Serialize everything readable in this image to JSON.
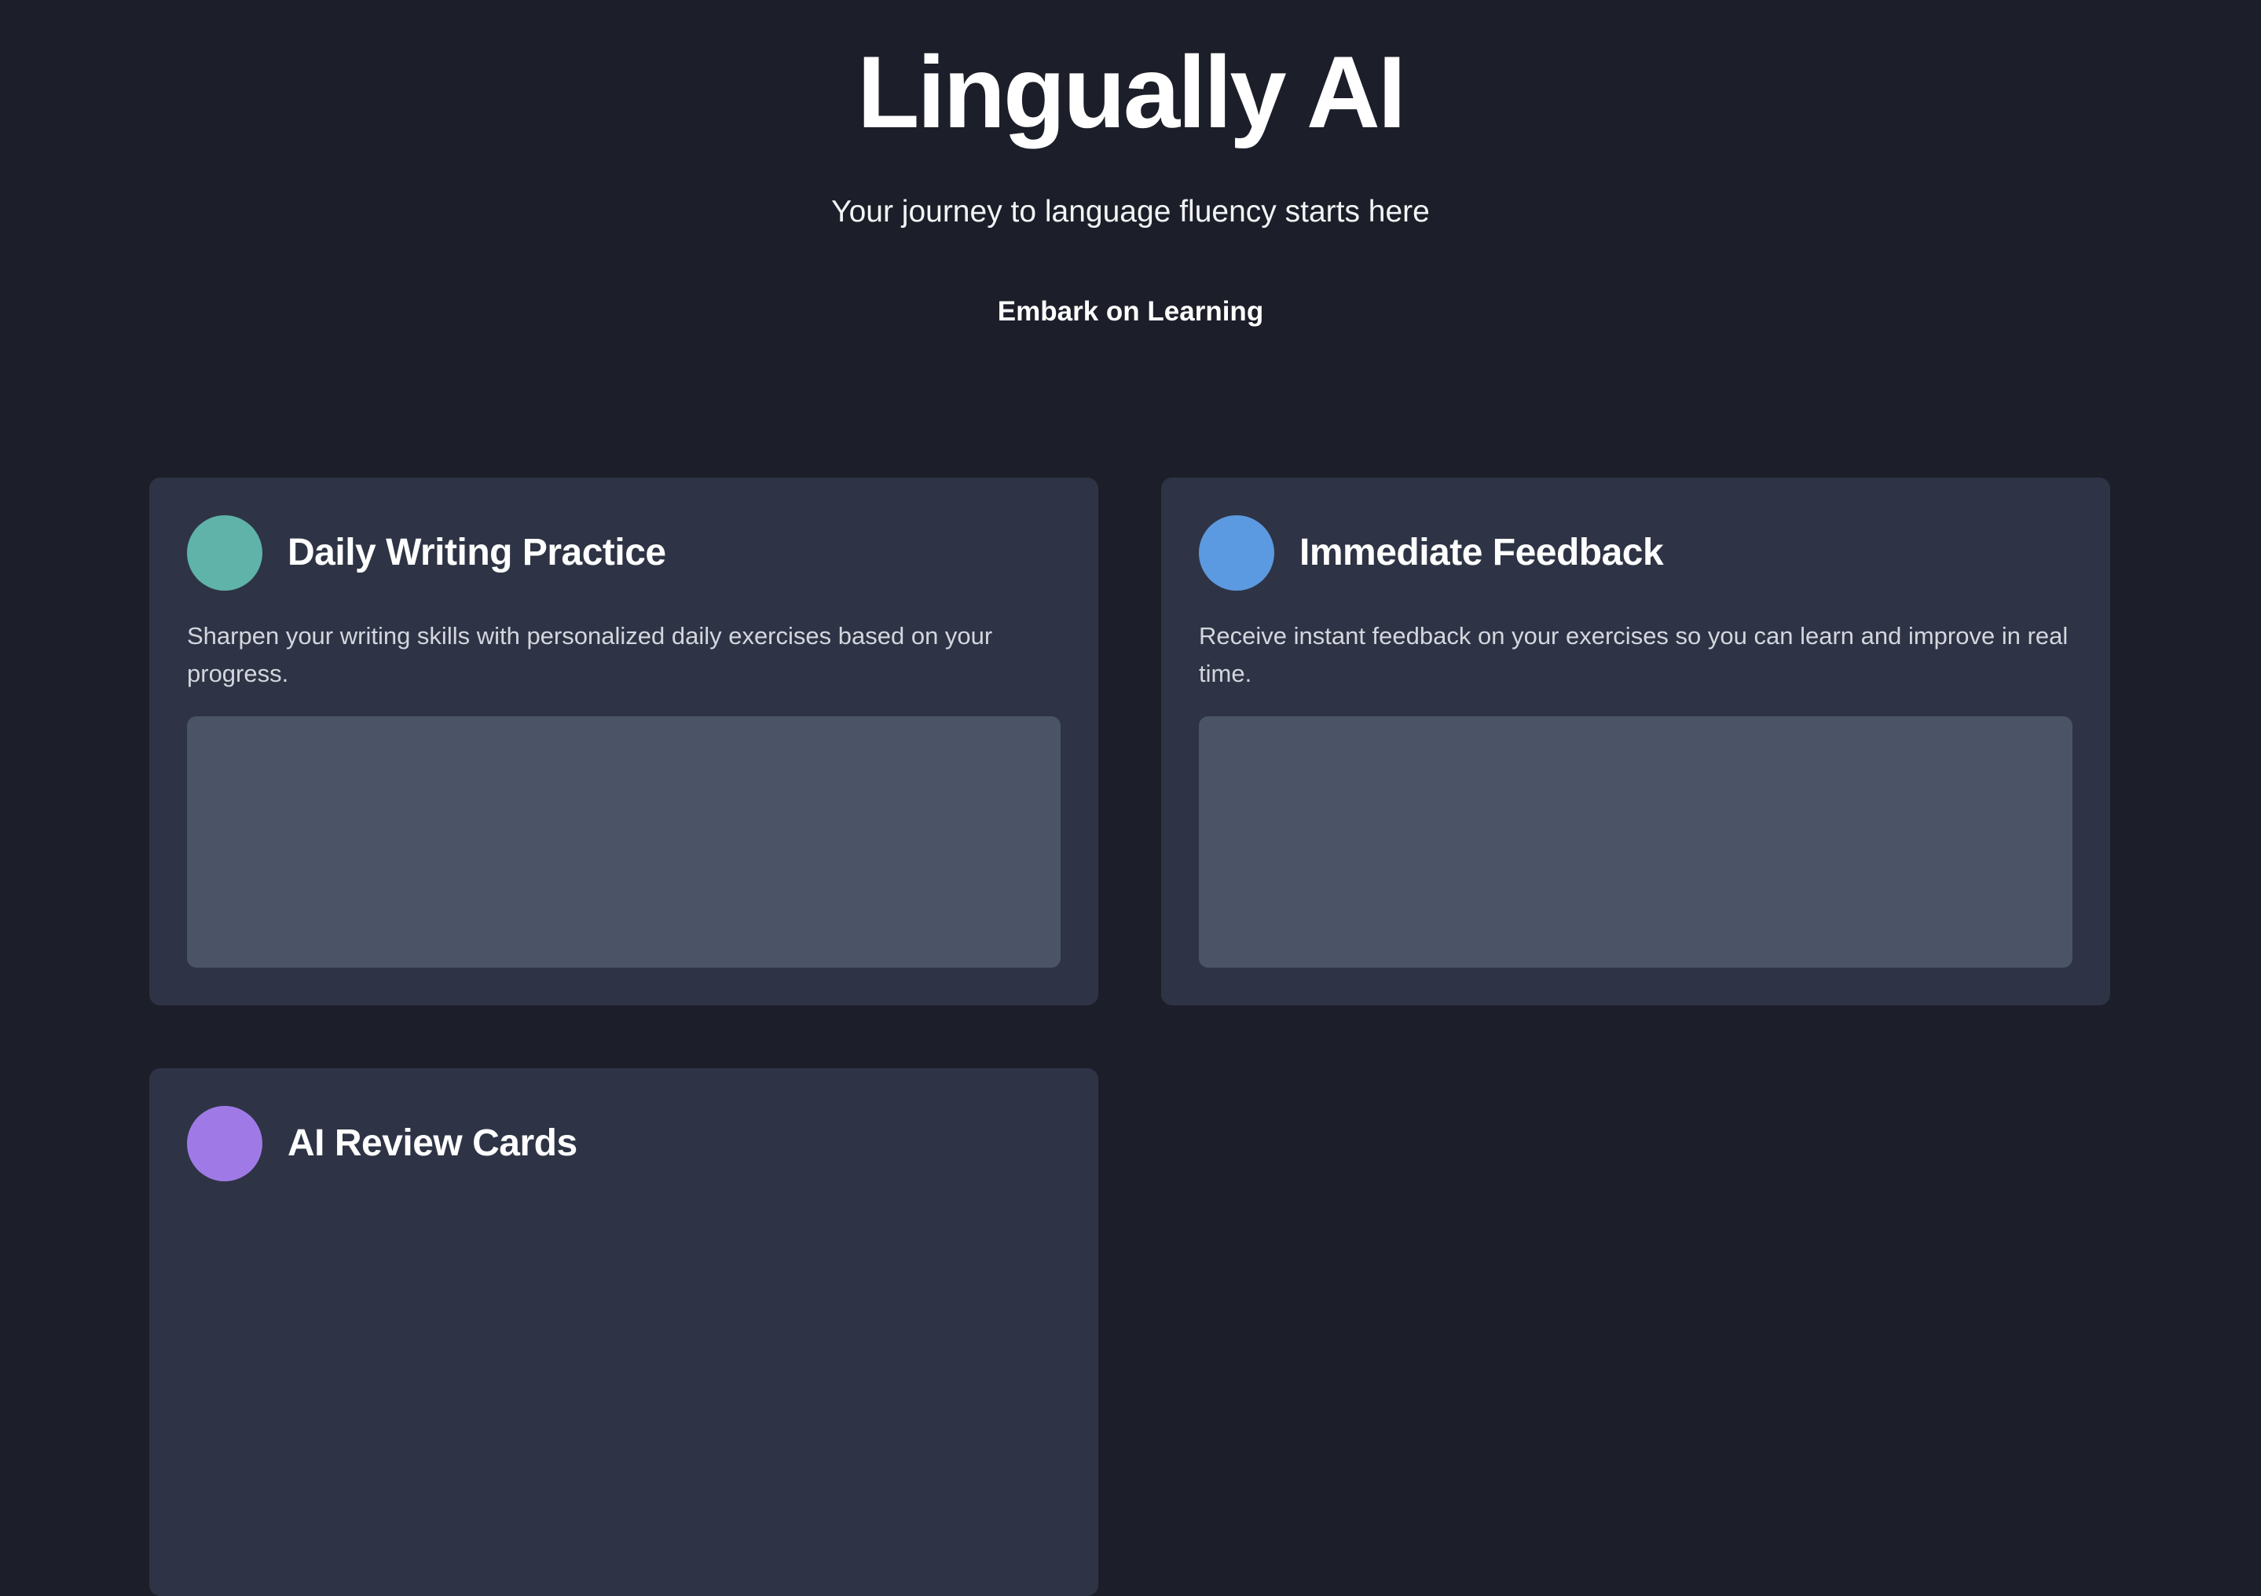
{
  "hero": {
    "title": "Lingually AI",
    "subtitle": "Your journey to language fluency starts here",
    "cta_label": "Embark on Learning"
  },
  "features": [
    {
      "title": "Daily Writing Practice",
      "description": "Sharpen your writing skills with personalized daily exercises based on your progress.",
      "accent_color": "#5fb3a9"
    },
    {
      "title": "Immediate Feedback",
      "description": "Receive instant feedback on your exercises so you can learn and improve in real time.",
      "accent_color": "#5b9ae0"
    },
    {
      "title": "AI Review Cards",
      "description": "",
      "accent_color": "#9f7ae6"
    }
  ],
  "theme": {
    "background": "#1c1f29",
    "card_background": "#2e3445",
    "media_placeholder": "#4b5466"
  }
}
